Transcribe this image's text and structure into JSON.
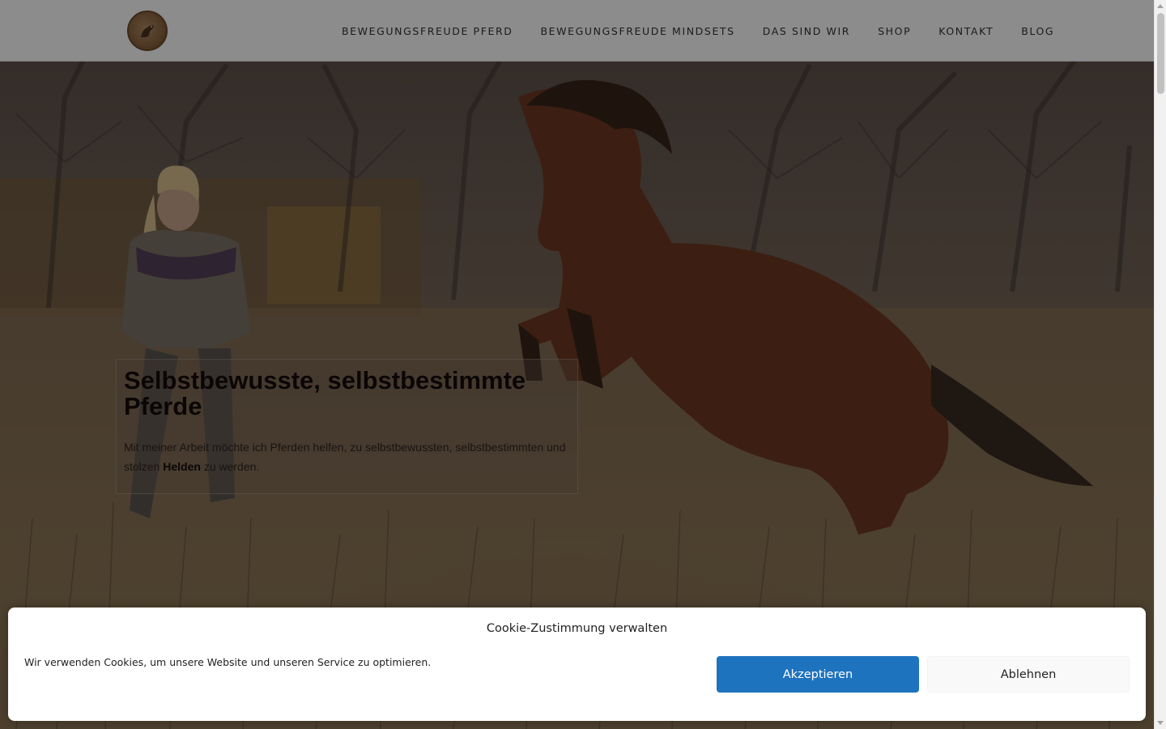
{
  "header": {
    "logo_name": "horse-logo",
    "nav": [
      {
        "label": "BEWEGUNGSFREUDE PFERD"
      },
      {
        "label": "BEWEGUNGSFREUDE MINDSETS"
      },
      {
        "label": "DAS SIND WIR"
      },
      {
        "label": "SHOP"
      },
      {
        "label": "KONTAKT"
      },
      {
        "label": "BLOG"
      }
    ]
  },
  "hero": {
    "title": "Selbstbewusste, selbstbestimmte Pferde",
    "text_before": "Mit meiner Arbeit möchte ich Pferden helfen, zu selbstbewussten, selbstbestimmten und stolzen ",
    "text_strong": "Helden",
    "text_after": " zu werden."
  },
  "cookie": {
    "title": "Cookie-Zustimmung verwalten",
    "message": "Wir verwenden Cookies, um unsere Website und unseren Service zu optimieren.",
    "accept_label": "Akzeptieren",
    "deny_label": "Ablehnen"
  },
  "colors": {
    "accept_button": "#1e73be",
    "header_bg": "#ffffff",
    "scrim": "rgba(0,0,0,0.45)"
  }
}
